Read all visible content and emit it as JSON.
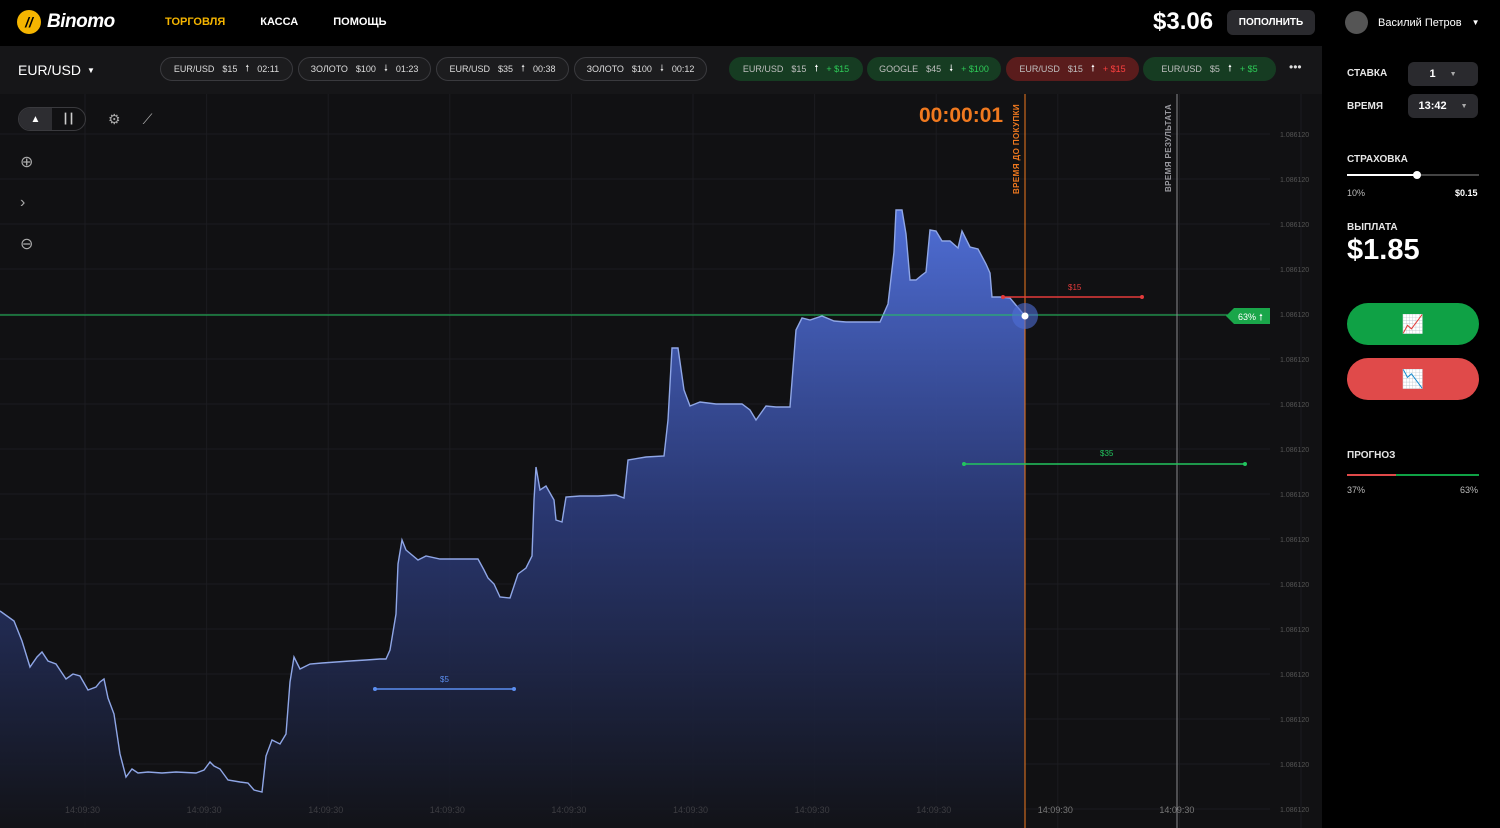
{
  "brand": {
    "name": "Binomo"
  },
  "nav": [
    "ТОРГОВЛЯ",
    "КАССА",
    "ПОМОЩЬ"
  ],
  "header": {
    "balance": "$3.06",
    "deposit": "ПОПОЛНИТЬ",
    "user": "Василий Петров"
  },
  "asset": {
    "name": "EUR/USD"
  },
  "open_trades": [
    {
      "asset": "EUR/USD",
      "amount": "$15",
      "dir": "up",
      "time": "02:11"
    },
    {
      "asset": "ЗОЛОТО",
      "amount": "$100",
      "dir": "down",
      "time": "01:23"
    },
    {
      "asset": "EUR/USD",
      "amount": "$35",
      "dir": "up",
      "time": "00:38"
    },
    {
      "asset": "ЗОЛОТО",
      "amount": "$100",
      "dir": "down",
      "time": "00:12"
    }
  ],
  "closed_trades": [
    {
      "asset": "EUR/USD",
      "amount": "$15",
      "dir": "up",
      "result": "+ $15",
      "status": "win"
    },
    {
      "asset": "GOOGLE",
      "amount": "$45",
      "dir": "down",
      "result": "+ $100",
      "status": "win"
    },
    {
      "asset": "EUR/USD",
      "amount": "$15",
      "dir": "up",
      "result": "+ $15",
      "status": "lose"
    },
    {
      "asset": "EUR/USD",
      "amount": "$5",
      "dir": "up",
      "result": "+ $5",
      "status": "win"
    }
  ],
  "chart": {
    "timer": "00:00:01",
    "purchase_label": "ВРЕМЯ ДО ПОКУПКИ",
    "result_label": "ВРЕМЯ РЕЗУЛЬТАТА",
    "price_labels": [
      "1.086120",
      "1.086120",
      "1.086120",
      "1.086120",
      "1.086120",
      "1.086120",
      "1.086120",
      "1.086120",
      "1.086120",
      "1.086120",
      "1.086120",
      "1.086120",
      "1.086120",
      "1.086120",
      "1.086120",
      "1.086120",
      "1.086120"
    ],
    "time_labels": [
      "14:09:30",
      "14:09:30",
      "14:09:30",
      "14:09:30",
      "14:09:30",
      "14:09:30",
      "14:09:30",
      "14:09:30",
      "14:09:30",
      "14:09:30"
    ],
    "current_badge": "63%",
    "trade_markers": [
      "$15",
      "$35",
      "$5"
    ],
    "colors": {
      "line": "#8fa6e6",
      "area_top": "#4f6ed6",
      "area_bottom": "#121318",
      "purchase": "#f0791f",
      "current": "#22c55e"
    }
  },
  "panel": {
    "stake_label": "СТАВКА",
    "stake_value": "1",
    "time_label": "ВРЕМЯ",
    "time_value": "13:42",
    "insurance_label": "СТРАХОВКА",
    "insurance_percent": "10%",
    "insurance_value": "$0.15",
    "insurance_level": 0.53,
    "payout_label": "ВЫПЛАТА",
    "payout_value": "$1.85",
    "forecast_label": "ПРОГНОЗ",
    "forecast_down": "37%",
    "forecast_up": "63%",
    "forecast_down_share": 0.37
  }
}
